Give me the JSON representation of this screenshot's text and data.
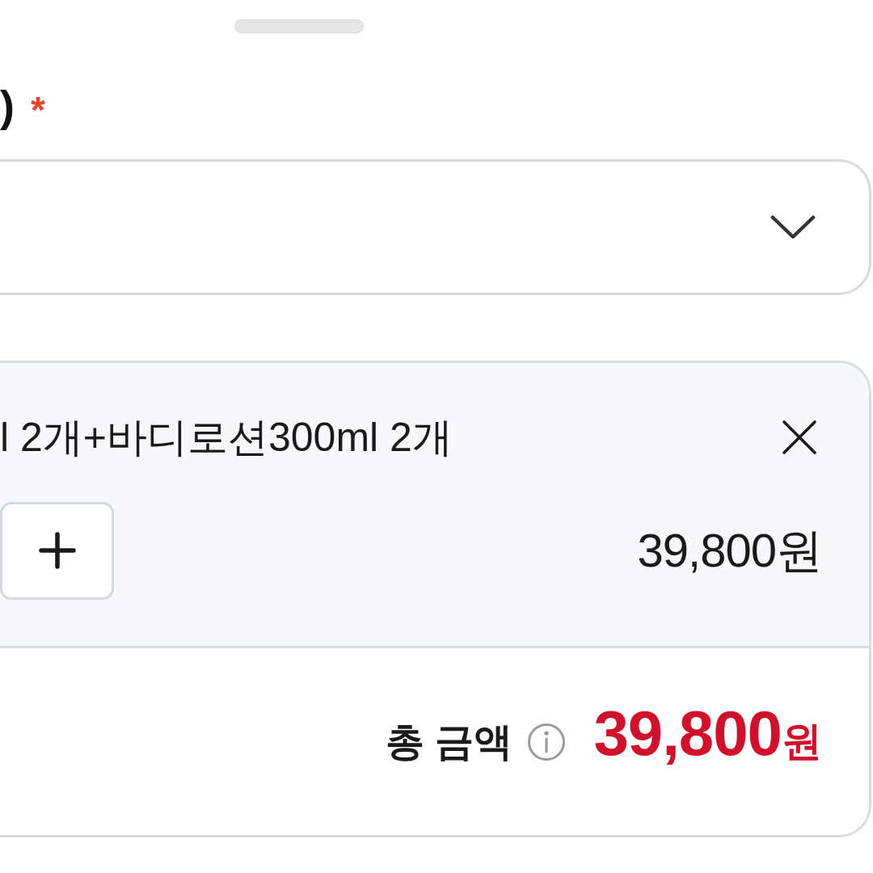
{
  "field": {
    "label": ")",
    "required_mark": "*"
  },
  "dropdown": {
    "expanded": false
  },
  "selected_option": {
    "name": "l 2개+바디로션300ml 2개",
    "price": "39,800원"
  },
  "total": {
    "label": "총 금액",
    "amount": "39,800",
    "unit": "원"
  }
}
